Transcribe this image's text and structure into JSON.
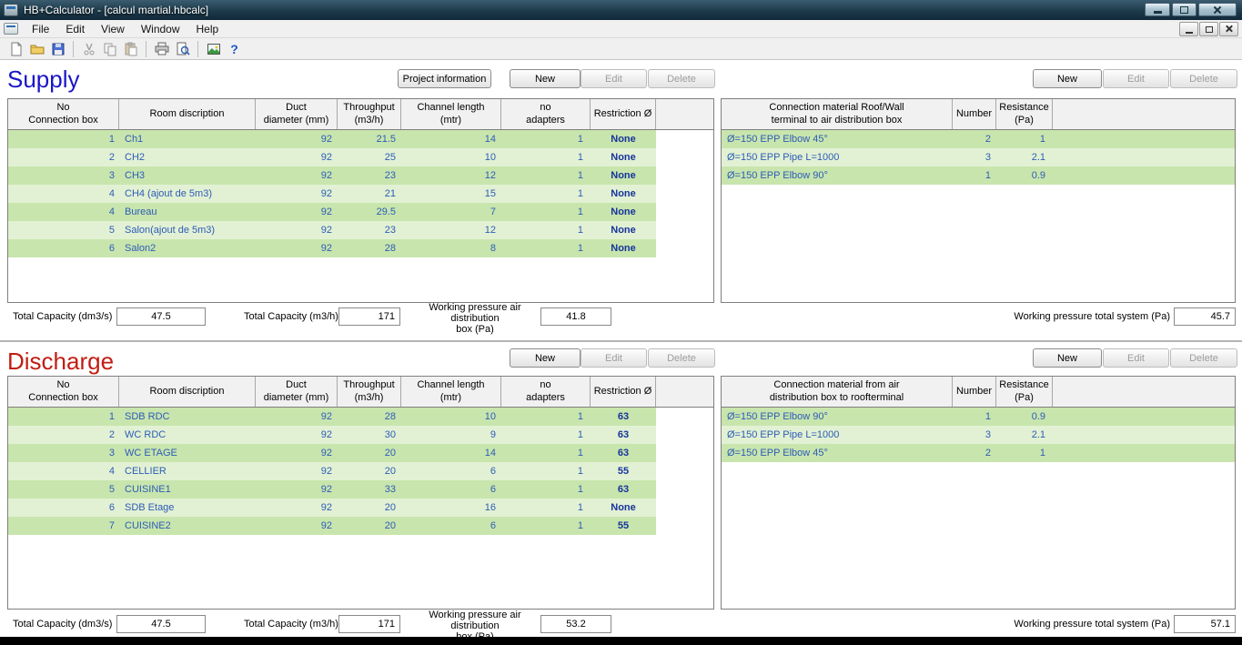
{
  "window": {
    "title": "HB+Calculator - [calcul martial.hbcalc]"
  },
  "menu": {
    "items": [
      "File",
      "Edit",
      "View",
      "Window",
      "Help"
    ]
  },
  "toolbar": {
    "icons": [
      "new-document-icon",
      "open-folder-icon",
      "save-icon",
      "cut-icon",
      "copy-icon",
      "paste-icon",
      "print-icon",
      "print-preview-icon",
      "image-icon",
      "help-icon"
    ],
    "help_glyph": "?"
  },
  "colors": {
    "supply_title": "#1a16c8",
    "discharge_title": "#c21d12",
    "row_dark": "#c8e5ad",
    "row_light": "#e2f1d3",
    "row_text": "#2d5cb8",
    "restriction_text": "#16349c"
  },
  "supply": {
    "title": "Supply",
    "project_info_button": "Project information",
    "left_buttons": {
      "new": "New",
      "edit": "Edit",
      "delete": "Delete"
    },
    "right_buttons": {
      "new": "New",
      "edit": "Edit",
      "delete": "Delete"
    },
    "left_table": {
      "headers": [
        "No\nConnection box",
        "Room discription",
        "Duct\ndiameter (mm)",
        "Throughput\n(m3/h)",
        "Channel length\n(mtr)",
        "no\nadapters",
        "Restriction Ø",
        ""
      ],
      "rows": [
        [
          "1",
          "Ch1",
          "92",
          "21.5",
          "14",
          "1",
          "None"
        ],
        [
          "2",
          "CH2",
          "92",
          "25",
          "10",
          "1",
          "None"
        ],
        [
          "3",
          "CH3",
          "92",
          "23",
          "12",
          "1",
          "None"
        ],
        [
          "4",
          "CH4 (ajout de 5m3)",
          "92",
          "21",
          "15",
          "1",
          "None"
        ],
        [
          "4",
          "Bureau",
          "92",
          "29.5",
          "7",
          "1",
          "None"
        ],
        [
          "5",
          "Salon(ajout de 5m3)",
          "92",
          "23",
          "12",
          "1",
          "None"
        ],
        [
          "6",
          "Salon2",
          "92",
          "28",
          "8",
          "1",
          "None"
        ]
      ]
    },
    "right_table": {
      "headers": [
        "Connection material Roof/Wall\nterminal to air distribution box",
        "Number",
        "Resistance\n(Pa)",
        ""
      ],
      "rows": [
        [
          "Ø=150 EPP Elbow 45°",
          "2",
          "1"
        ],
        [
          "Ø=150 EPP Pipe L=1000",
          "3",
          "2.1"
        ],
        [
          "Ø=150 EPP Elbow 90°",
          "1",
          "0.9"
        ]
      ]
    },
    "totals": {
      "capacity_dm3s_label": "Total Capacity (dm3/s)",
      "capacity_dm3s": "47.5",
      "capacity_m3h_label": "Total Capacity (m3/h)",
      "capacity_m3h": "171",
      "wp_box_label": "Working pressure air distribution\nbox (Pa)",
      "wp_box": "41.8",
      "wp_system_label": "Working pressure total system (Pa)",
      "wp_system": "45.7"
    }
  },
  "discharge": {
    "title": "Discharge",
    "left_buttons": {
      "new": "New",
      "edit": "Edit",
      "delete": "Delete"
    },
    "right_buttons": {
      "new": "New",
      "edit": "Edit",
      "delete": "Delete"
    },
    "left_table": {
      "headers": [
        "No\nConnection box",
        "Room discription",
        "Duct\ndiameter (mm)",
        "Throughput\n(m3/h)",
        "Channel length\n(mtr)",
        "no\nadapters",
        "Restriction Ø",
        ""
      ],
      "rows": [
        [
          "1",
          "SDB RDC",
          "92",
          "28",
          "10",
          "1",
          "63"
        ],
        [
          "2",
          "WC RDC",
          "92",
          "30",
          "9",
          "1",
          "63"
        ],
        [
          "3",
          "WC ETAGE",
          "92",
          "20",
          "14",
          "1",
          "63"
        ],
        [
          "4",
          "CELLIER",
          "92",
          "20",
          "6",
          "1",
          "55"
        ],
        [
          "5",
          "CUISINE1",
          "92",
          "33",
          "6",
          "1",
          "63"
        ],
        [
          "6",
          "SDB Etage",
          "92",
          "20",
          "16",
          "1",
          "None"
        ],
        [
          "7",
          "CUISINE2",
          "92",
          "20",
          "6",
          "1",
          "55"
        ]
      ]
    },
    "right_table": {
      "headers": [
        "Connection material from air\ndistribution box to roofterminal",
        "Number",
        "Resistance\n(Pa)",
        ""
      ],
      "rows": [
        [
          "Ø=150 EPP Elbow 90°",
          "1",
          "0.9"
        ],
        [
          "Ø=150 EPP Pipe L=1000",
          "3",
          "2.1"
        ],
        [
          "Ø=150 EPP Elbow 45°",
          "2",
          "1"
        ]
      ]
    },
    "totals": {
      "capacity_dm3s_label": "Total Capacity (dm3/s)",
      "capacity_dm3s": "47.5",
      "capacity_m3h_label": "Total Capacity (m3/h)",
      "capacity_m3h": "171",
      "wp_box_label": "Working pressure air distribution\nbox (Pa)",
      "wp_box": "53.2",
      "wp_system_label": "Working pressure total system (Pa)",
      "wp_system": "57.1"
    }
  }
}
